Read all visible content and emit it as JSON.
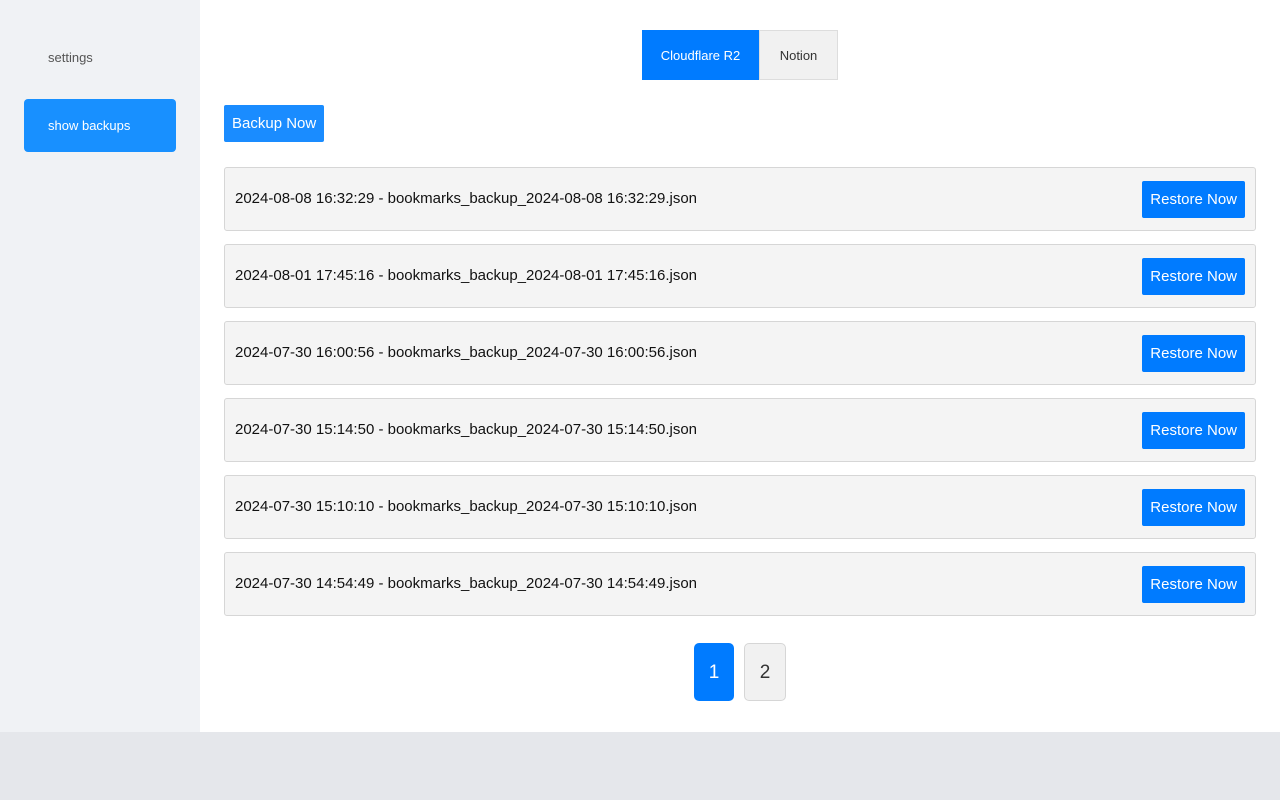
{
  "sidebar": {
    "items": [
      {
        "label": "settings",
        "active": false
      },
      {
        "label": "show backups",
        "active": true
      }
    ]
  },
  "tabs": [
    {
      "label": "Cloudflare R2",
      "active": true
    },
    {
      "label": "Notion",
      "active": false
    }
  ],
  "backup_button_label": "Backup Now",
  "restore_button_label": "Restore Now",
  "backups": [
    {
      "text": "2024-08-08 16:32:29 - bookmarks_backup_2024-08-08 16:32:29.json"
    },
    {
      "text": "2024-08-01 17:45:16 - bookmarks_backup_2024-08-01 17:45:16.json"
    },
    {
      "text": "2024-07-30 16:00:56 - bookmarks_backup_2024-07-30 16:00:56.json"
    },
    {
      "text": "2024-07-30 15:14:50 - bookmarks_backup_2024-07-30 15:14:50.json"
    },
    {
      "text": "2024-07-30 15:10:10 - bookmarks_backup_2024-07-30 15:10:10.json"
    },
    {
      "text": "2024-07-30 14:54:49 - bookmarks_backup_2024-07-30 14:54:49.json"
    }
  ],
  "pagination": {
    "pages": [
      "1",
      "2"
    ],
    "current": "1"
  },
  "colors": {
    "accent": "#007bff",
    "sidebar_active": "#1890ff",
    "sidebar_bg": "#f0f2f5",
    "row_bg": "#f4f4f4"
  }
}
